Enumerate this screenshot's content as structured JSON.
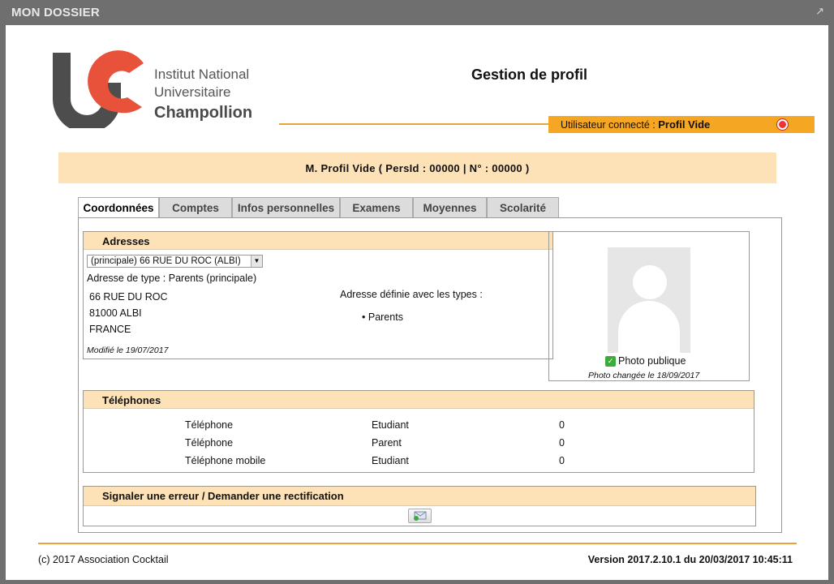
{
  "window": {
    "title": "MON DOSSIER",
    "expand_icon": "expand-arrow-icon"
  },
  "logo": {
    "line1": "Institut National",
    "line2": "Universitaire",
    "line3": "Champollion",
    "colors": {
      "grey": "#4d4d4d",
      "red": "#e8523a"
    }
  },
  "header": {
    "title": "Gestion de profil"
  },
  "user_bar": {
    "label": "Utilisateur connecté :",
    "user": "Profil Vide",
    "color": "#f5a623"
  },
  "banner": {
    "text": "M. Profil Vide ( PersId : 00000 | N° : 00000 )"
  },
  "tabs": [
    {
      "label": "Coordonnées",
      "active": true
    },
    {
      "label": "Comptes"
    },
    {
      "label": "Infos personnelles"
    },
    {
      "label": "Examens"
    },
    {
      "label": "Moyennes"
    },
    {
      "label": "Scolarité"
    }
  ],
  "adresses": {
    "title": "Adresses",
    "selected": "(principale) 66 RUE DU ROC (ALBI)",
    "type_line": "Adresse de type : Parents (principale)",
    "address": [
      "66 RUE DU ROC",
      "81000  ALBI",
      "FRANCE"
    ],
    "modified": "Modifié le 19/07/2017",
    "types_label": "Adresse définie avec les types :",
    "types": [
      "Parents"
    ]
  },
  "photo": {
    "label": "Photo publique",
    "changed": "Photo changée le 18/09/2017"
  },
  "telephones": {
    "title": "Téléphones",
    "rows": [
      {
        "type": "Téléphone",
        "owner": "Etudiant",
        "number": "0"
      },
      {
        "type": "Téléphone",
        "owner": "Parent",
        "number": "0"
      },
      {
        "type": "Téléphone mobile",
        "owner": "Etudiant",
        "number": "0"
      }
    ]
  },
  "signaler": {
    "title": "Signaler une erreur / Demander une rectification"
  },
  "footer": {
    "left": "(c) 2017 Association Cocktail",
    "right": "Version 2017.2.10.1 du 20/03/2017 10:45:11"
  }
}
